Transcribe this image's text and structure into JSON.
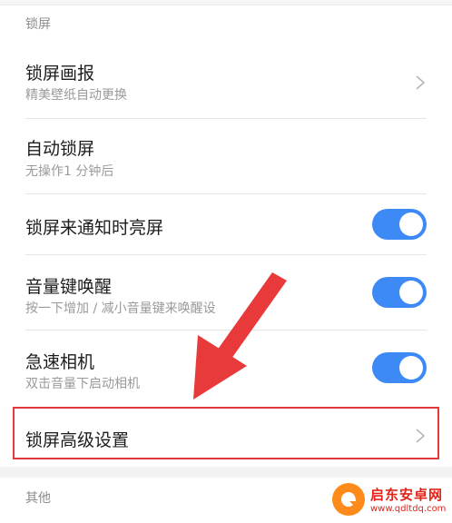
{
  "section_lock": "锁屏",
  "section_other": "其他",
  "items": [
    {
      "title": "锁屏画报",
      "subtitle": "精美壁纸自动更换",
      "control": "chevron"
    },
    {
      "title": "自动锁屏",
      "subtitle": "无操作1 分钟后",
      "control": "none"
    },
    {
      "title": "锁屏来通知时亮屏",
      "subtitle": "",
      "control": "toggle",
      "on": true
    },
    {
      "title": "音量键唤醒",
      "subtitle": "按一下增加 / 减小音量键来唤醒设",
      "control": "toggle",
      "on": true
    },
    {
      "title": "急速相机",
      "subtitle": "双击音量下启动相机",
      "control": "toggle",
      "on": true
    },
    {
      "title": "锁屏高级设置",
      "subtitle": "",
      "control": "chevron"
    }
  ],
  "watermark": {
    "name": "启东安卓网",
    "url": "www.qdltdq.com"
  },
  "colors": {
    "accent": "#3d8af7",
    "highlight": "#e23b3b",
    "watermark": "#e2231a"
  }
}
